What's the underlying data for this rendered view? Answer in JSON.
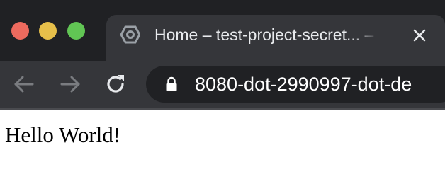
{
  "window": {
    "controls": [
      "close",
      "minimize",
      "maximize"
    ]
  },
  "tab": {
    "title": "Home – test-project-secret... –",
    "icon": "cloud-hexagon-icon",
    "close_icon": "close-icon"
  },
  "toolbar": {
    "back_icon": "back-arrow-icon",
    "forward_icon": "forward-arrow-icon",
    "reload_icon": "reload-icon"
  },
  "omnibox": {
    "lock_icon": "lock-icon",
    "url": "8080-dot-2990997-dot-de"
  },
  "page": {
    "body_text": "Hello World!"
  },
  "colors": {
    "titlebar": "#202124",
    "tab": "#35363a",
    "omnibox": "#202124",
    "close": "#ed6a5e",
    "minimize": "#e6bf4a",
    "maximize": "#61c554"
  }
}
